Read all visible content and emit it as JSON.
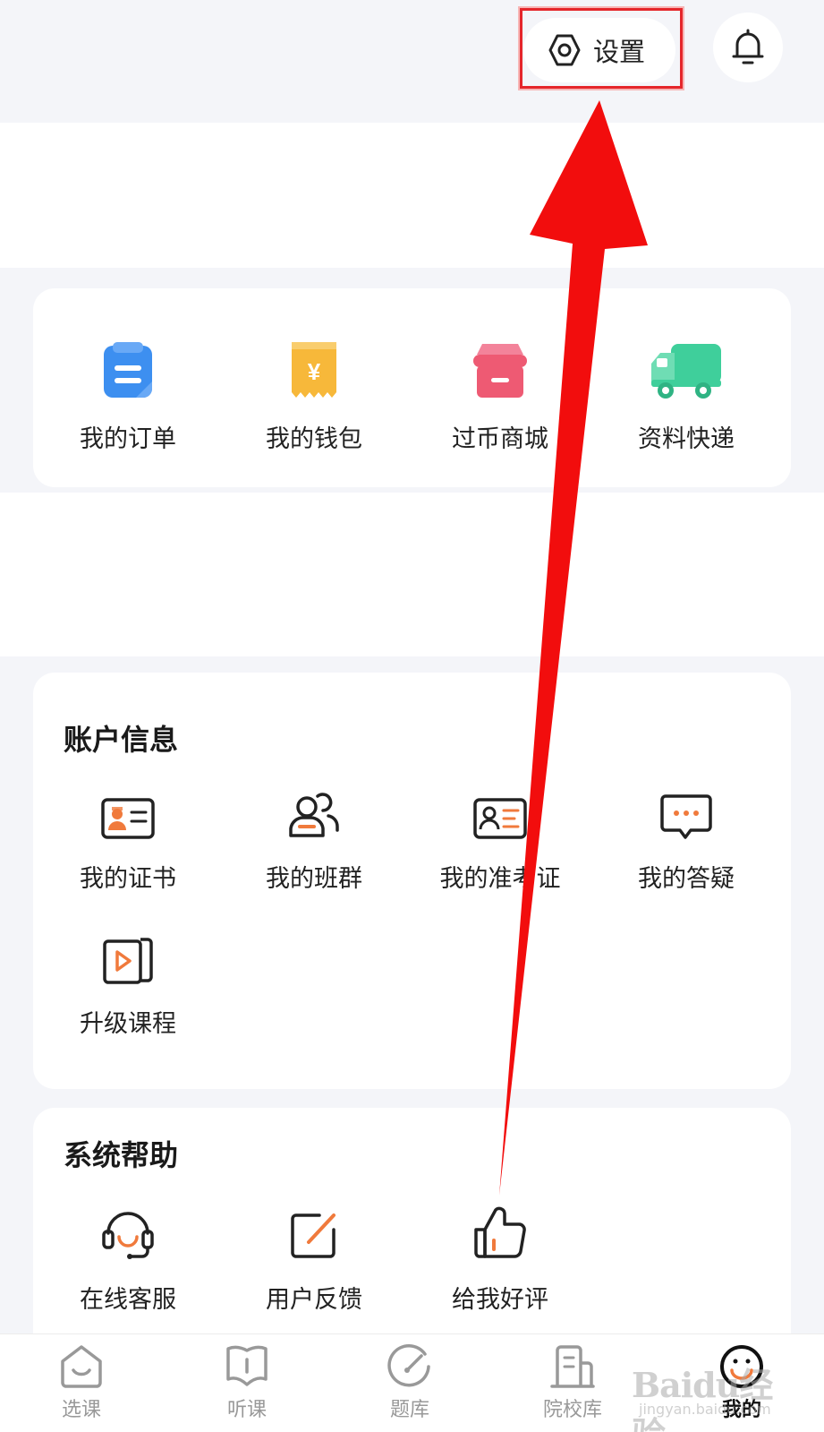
{
  "header": {
    "settings_label": "设置"
  },
  "quick_links": [
    {
      "label": "我的订单",
      "icon": "order-icon"
    },
    {
      "label": "我的钱包",
      "icon": "wallet-icon"
    },
    {
      "label": "过币商城",
      "icon": "shop-icon"
    },
    {
      "label": "资料快递",
      "icon": "delivery-truck-icon"
    }
  ],
  "account": {
    "title": "账户信息",
    "items": [
      {
        "label": "我的证书",
        "icon": "certificate-icon"
      },
      {
        "label": "我的班群",
        "icon": "class-group-icon"
      },
      {
        "label": "我的准考证",
        "icon": "admission-ticket-icon"
      },
      {
        "label": "我的答疑",
        "icon": "qa-chat-icon"
      },
      {
        "label": "升级课程",
        "icon": "upgrade-course-icon"
      }
    ]
  },
  "help": {
    "title": "系统帮助",
    "items": [
      {
        "label": "在线客服",
        "icon": "headset-icon"
      },
      {
        "label": "用户反馈",
        "icon": "feedback-edit-icon"
      },
      {
        "label": "给我好评",
        "icon": "thumbs-up-icon"
      }
    ]
  },
  "tabbar": {
    "tabs": [
      {
        "label": "选课",
        "icon": "select-course-icon"
      },
      {
        "label": "听课",
        "icon": "listen-course-icon"
      },
      {
        "label": "题库",
        "icon": "question-bank-icon"
      },
      {
        "label": "院校库",
        "icon": "school-library-icon"
      },
      {
        "label": "我的",
        "icon": "profile-icon"
      }
    ],
    "active": "我的"
  },
  "watermark": {
    "main": "Baidu经验",
    "sub": "jingyan.baidu.com"
  },
  "colors": {
    "accent_orange": "#f07a3c",
    "annotation_red": "#f20d0d",
    "blue": "#3d8ff0",
    "gold": "#f7b83a",
    "pink": "#ee5a73",
    "green": "#3fcf9b"
  }
}
